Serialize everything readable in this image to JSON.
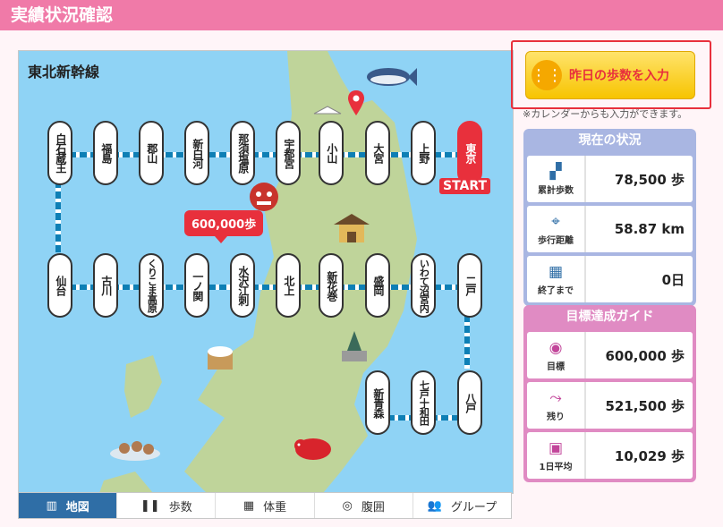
{
  "header": {
    "title": "実績状況確認"
  },
  "map": {
    "title": "東北新幹線",
    "bubble": "600,000歩",
    "start_label": "START",
    "stations_top": [
      "白石蔵王",
      "福島",
      "郡山",
      "新白河",
      "那須塩原",
      "宇都宮",
      "小山",
      "大宮",
      "上野",
      "東京"
    ],
    "stations_bottom": [
      "仙台",
      "古川",
      "くりこま高原",
      "一ノ関",
      "水沢江刺",
      "北上",
      "新花巻",
      "盛岡",
      "いわて沼宮内",
      "二戸"
    ],
    "stations_lower": [
      "新青森",
      "七戸十和田",
      "八戸"
    ]
  },
  "tabs": [
    {
      "label": "地図",
      "icon": "map-icon"
    },
    {
      "label": "歩数",
      "icon": "footprints-icon"
    },
    {
      "label": "体重",
      "icon": "scale-icon"
    },
    {
      "label": "腹囲",
      "icon": "waist-icon"
    },
    {
      "label": "グループ",
      "icon": "group-icon"
    }
  ],
  "input_button": {
    "label": "昨日の歩数を入力"
  },
  "note": "※カレンダーからも入力ができます。",
  "status": {
    "title": "現在の状況",
    "rows": [
      {
        "label": "累計歩数",
        "value": "78,500 歩",
        "icon": "footprints-icon"
      },
      {
        "label": "歩行距離",
        "value": "58.87 km",
        "icon": "route-icon"
      },
      {
        "label": "終了まで",
        "value": "0日",
        "icon": "calendar-icon"
      }
    ]
  },
  "guide": {
    "title": "目標達成ガイド",
    "rows": [
      {
        "label": "目標",
        "value": "600,000 歩",
        "icon": "goal-pin-icon"
      },
      {
        "label": "残り",
        "value": "521,500 歩",
        "icon": "remaining-route-icon"
      },
      {
        "label": "1日平均",
        "value": "10,029 歩",
        "icon": "daily-calendar-icon"
      }
    ]
  },
  "colors": {
    "header": "#f07aa8",
    "accent_red": "#e8303c",
    "rail": "#0e7fb5",
    "sea": "#8fd3f5",
    "land": "#bfd49a"
  }
}
